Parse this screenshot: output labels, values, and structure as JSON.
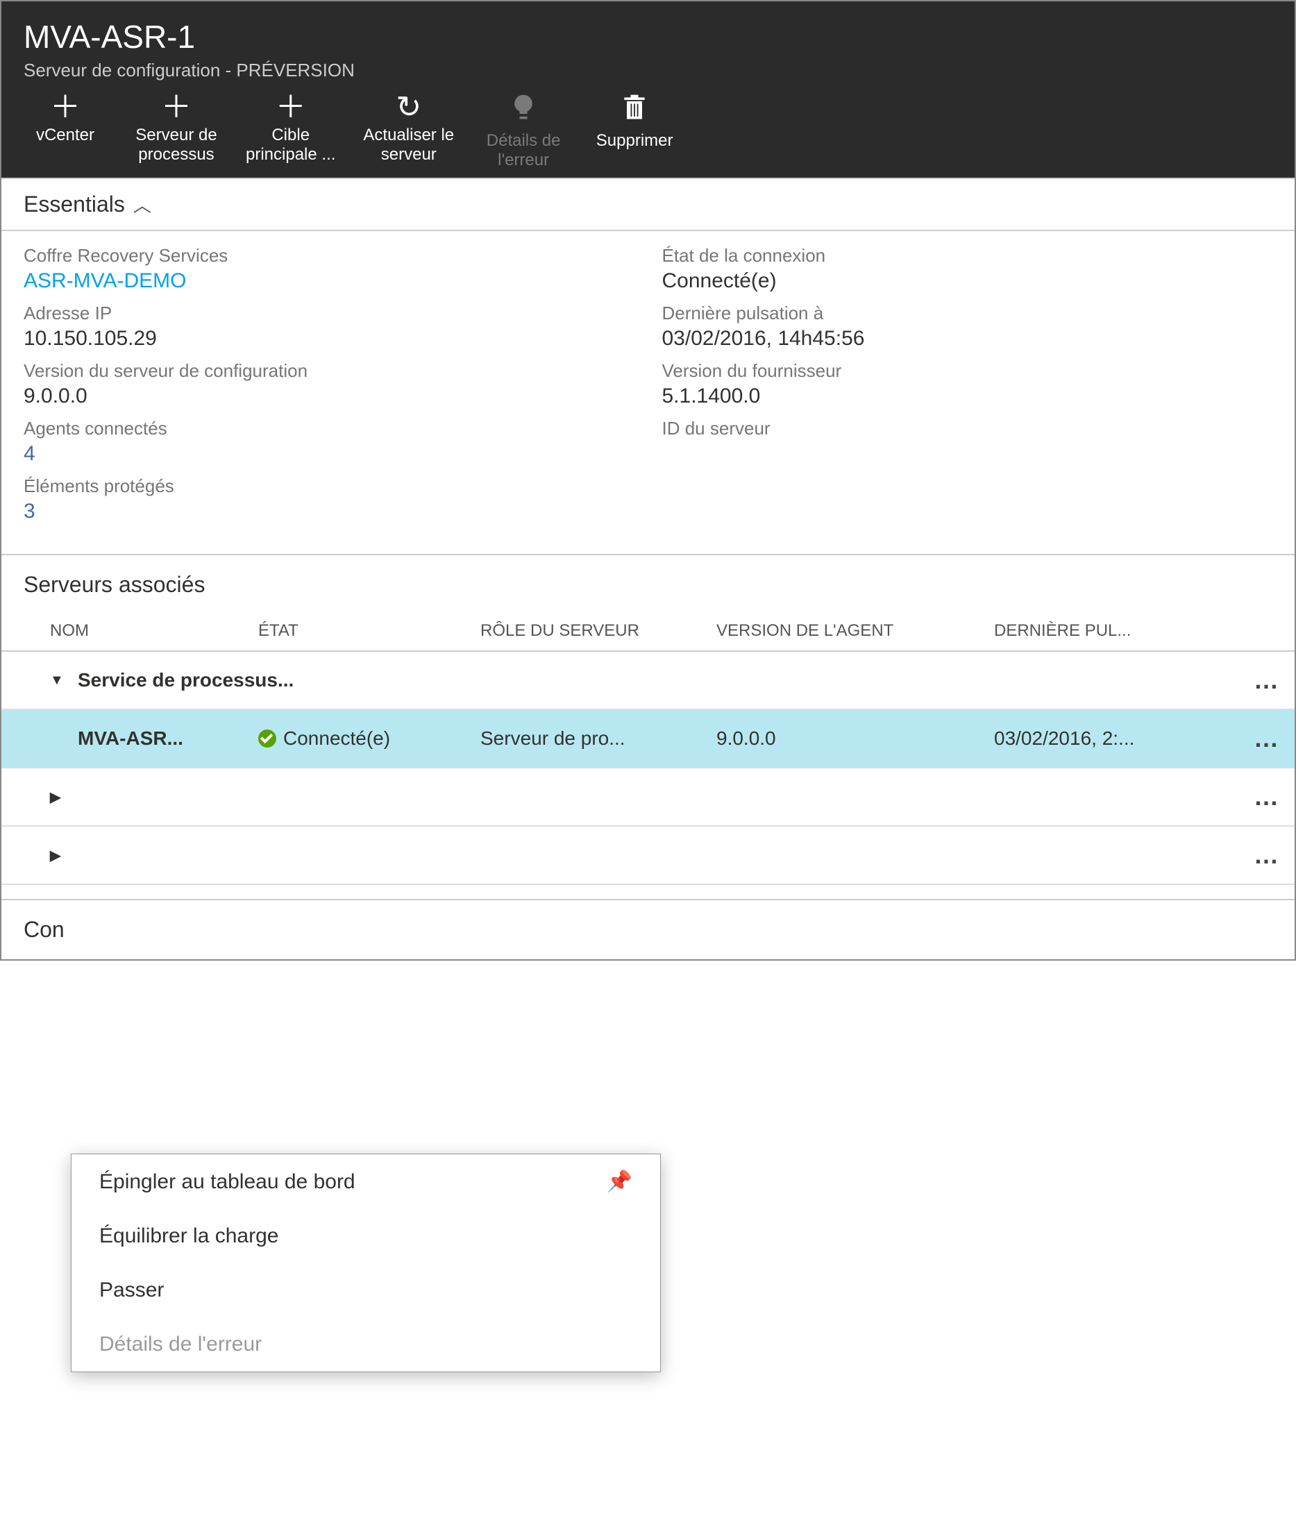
{
  "header": {
    "title": "MVA-ASR-1",
    "subtitle": "Serveur de configuration - PRÉVERSION"
  },
  "toolbar": {
    "vcenter": "vCenter",
    "process_server": "Serveur de\nprocessus",
    "master_target": "Cible\nprincipale ...",
    "refresh": "Actualiser le\nserveur",
    "error_details": "Détails de\nl'erreur",
    "delete": "Supprimer"
  },
  "essentials": {
    "label": "Essentials",
    "left": {
      "vault_label": "Coffre Recovery Services",
      "vault_value": "ASR-MVA-DEMO",
      "ip_label": "Adresse IP",
      "ip_value": "10.150.105.29",
      "cfg_version_label": "Version du serveur de configuration",
      "cfg_version_value": "9.0.0.0",
      "agents_label": "Agents connectés",
      "agents_value": "4",
      "protected_label": "Éléments protégés",
      "protected_value": "3"
    },
    "right": {
      "conn_label": "État de la connexion",
      "conn_value": "Connecté(e)",
      "heartbeat_label": "Dernière pulsation à",
      "heartbeat_value": "03/02/2016, 14h45:56",
      "provider_label": "Version du fournisseur",
      "provider_value": "5.1.1400.0",
      "server_id_label": "ID du serveur",
      "server_id_value": ""
    }
  },
  "associated": {
    "title": "Serveurs associés",
    "columns": {
      "name": "NOM",
      "state": "ÉTAT",
      "role": "RÔLE DU SERVEUR",
      "agent_version": "VERSION DE L'AGENT",
      "last_heartbeat": "DERNIÈRE PUL..."
    },
    "group1": "Service de processus...",
    "row1": {
      "name": "MVA-ASR...",
      "state": "Connecté(e)",
      "role": "Serveur de pro...",
      "version": "9.0.0.0",
      "heartbeat": "03/02/2016, 2:..."
    }
  },
  "context_menu": {
    "pin": "Épingler au tableau de bord",
    "balance": "Équilibrer la charge",
    "switch": "Passer",
    "error_details": "Détails de l'erreur"
  },
  "bottom_cut": "Con"
}
